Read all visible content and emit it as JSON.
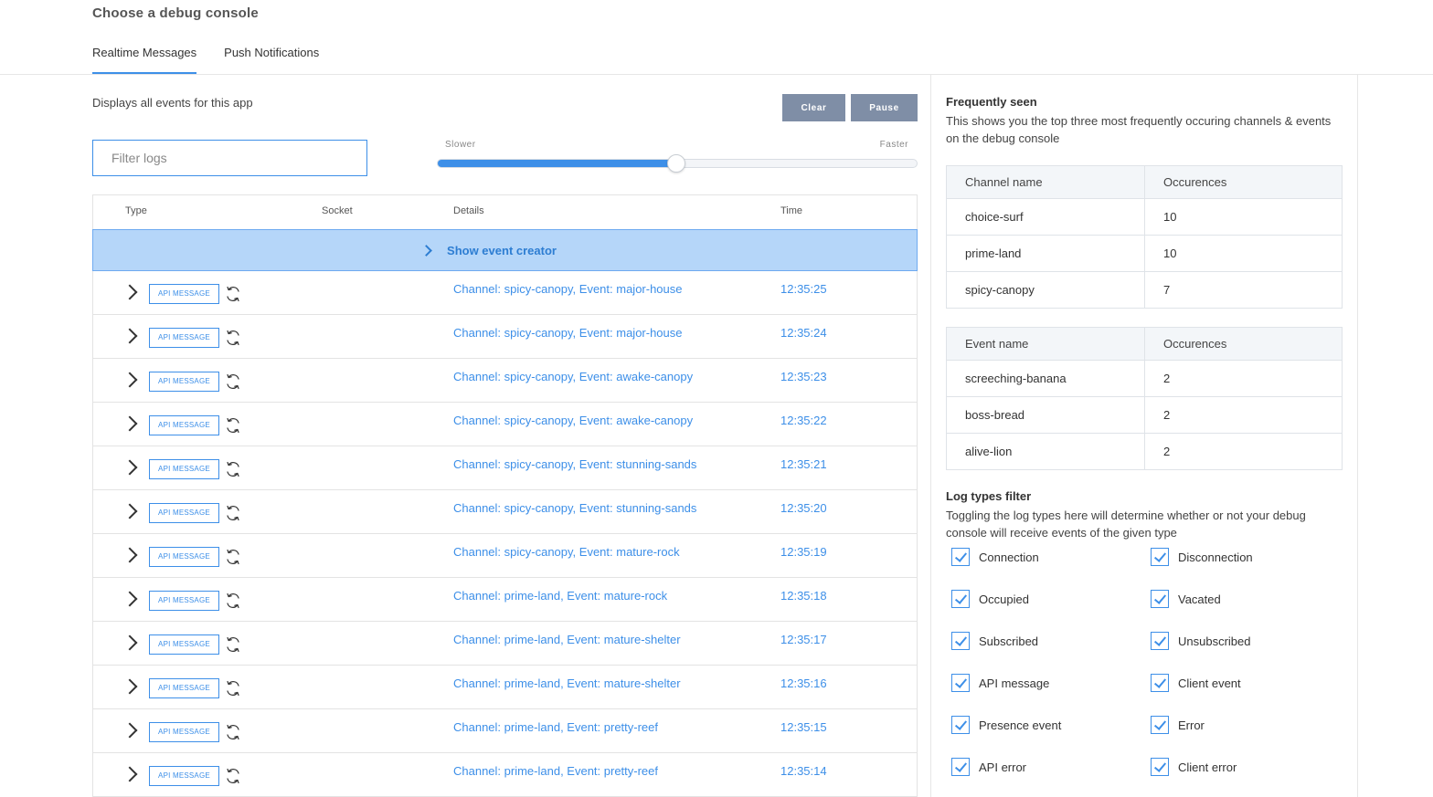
{
  "page": {
    "title": "Choose a debug console"
  },
  "tabs": [
    {
      "label": "Realtime Messages",
      "active": true
    },
    {
      "label": "Push Notifications",
      "active": false
    }
  ],
  "left": {
    "description": "Displays all events for this app",
    "buttons": {
      "clear": "Clear",
      "pause": "Pause"
    },
    "filter": {
      "placeholder": "Filter logs",
      "value": ""
    },
    "slider": {
      "slower_label": "Slower",
      "faster_label": "Faster",
      "value_percent": 49.8
    },
    "table": {
      "headers": {
        "type": "Type",
        "socket": "Socket",
        "details": "Details",
        "time": "Time"
      },
      "event_creator": "Show event creator",
      "rows": [
        {
          "badge": "API MESSAGE",
          "details": "Channel: spicy-canopy, Event: major-house",
          "time": "12:35:25"
        },
        {
          "badge": "API MESSAGE",
          "details": "Channel: spicy-canopy, Event: major-house",
          "time": "12:35:24"
        },
        {
          "badge": "API MESSAGE",
          "details": "Channel: spicy-canopy, Event: awake-canopy",
          "time": "12:35:23"
        },
        {
          "badge": "API MESSAGE",
          "details": "Channel: spicy-canopy, Event: awake-canopy",
          "time": "12:35:22"
        },
        {
          "badge": "API MESSAGE",
          "details": "Channel: spicy-canopy, Event: stunning-sands",
          "time": "12:35:21"
        },
        {
          "badge": "API MESSAGE",
          "details": "Channel: spicy-canopy, Event: stunning-sands",
          "time": "12:35:20"
        },
        {
          "badge": "API MESSAGE",
          "details": "Channel: spicy-canopy, Event: mature-rock",
          "time": "12:35:19"
        },
        {
          "badge": "API MESSAGE",
          "details": "Channel: prime-land, Event: mature-rock",
          "time": "12:35:18"
        },
        {
          "badge": "API MESSAGE",
          "details": "Channel: prime-land, Event: mature-shelter",
          "time": "12:35:17"
        },
        {
          "badge": "API MESSAGE",
          "details": "Channel: prime-land, Event: mature-shelter",
          "time": "12:35:16"
        },
        {
          "badge": "API MESSAGE",
          "details": "Channel: prime-land, Event: pretty-reef",
          "time": "12:35:15"
        },
        {
          "badge": "API MESSAGE",
          "details": "Channel: prime-land, Event: pretty-reef",
          "time": "12:35:14"
        }
      ]
    }
  },
  "right": {
    "frequently_seen": {
      "title": "Frequently seen",
      "description": "This shows you the top three most frequently occuring channels & events on the debug console",
      "channels": {
        "headers": [
          "Channel name",
          "Occurences"
        ],
        "rows": [
          [
            "choice-surf",
            "10"
          ],
          [
            "prime-land",
            "10"
          ],
          [
            "spicy-canopy",
            "7"
          ]
        ]
      },
      "events": {
        "headers": [
          "Event name",
          "Occurences"
        ],
        "rows": [
          [
            "screeching-banana",
            "2"
          ],
          [
            "boss-bread",
            "2"
          ],
          [
            "alive-lion",
            "2"
          ]
        ]
      }
    },
    "log_types": {
      "title": "Log types filter",
      "description": "Toggling the log types here will determine whether or not your debug console will receive events of the given type",
      "items": [
        {
          "label": "Connection",
          "checked": true
        },
        {
          "label": "Disconnection",
          "checked": true
        },
        {
          "label": "Occupied",
          "checked": true
        },
        {
          "label": "Vacated",
          "checked": true
        },
        {
          "label": "Subscribed",
          "checked": true
        },
        {
          "label": "Unsubscribed",
          "checked": true
        },
        {
          "label": "API message",
          "checked": true
        },
        {
          "label": "Client event",
          "checked": true
        },
        {
          "label": "Presence event",
          "checked": true
        },
        {
          "label": "Error",
          "checked": true
        },
        {
          "label": "API error",
          "checked": true
        },
        {
          "label": "Client error",
          "checked": true
        }
      ]
    }
  },
  "colors": {
    "accent": "#3d8fe8",
    "button": "#7f8ea6",
    "creator_bg": "#b5d6f9"
  }
}
